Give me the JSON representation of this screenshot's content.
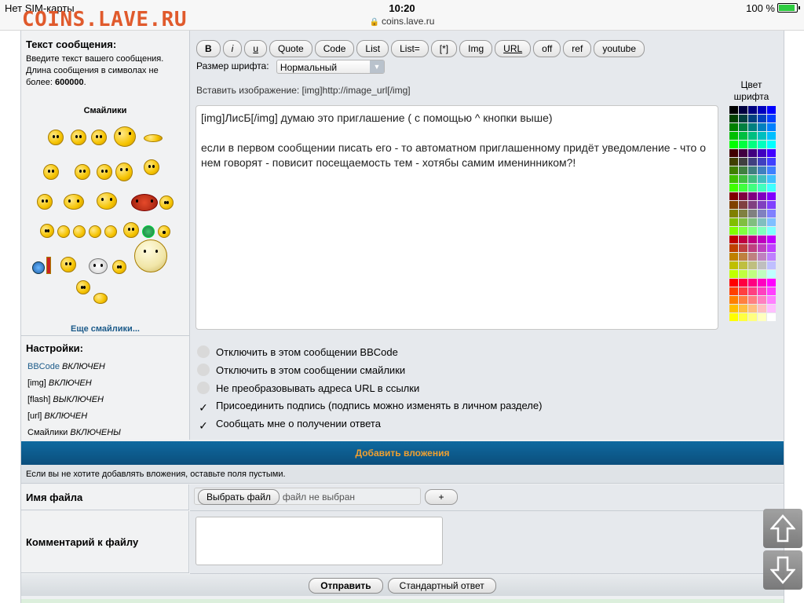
{
  "status": {
    "carrier": "Нет SIM-карты",
    "time": "10:20",
    "battery": "100 %"
  },
  "browser": {
    "url": "coins.lave.ru",
    "site_title": "COINS.LAVE.RU"
  },
  "message_section": {
    "title": "Текст сообщения:",
    "hint_line1": "Введите текст вашего сообщения.",
    "hint_line2": "Длина сообщения в символах не",
    "hint_prefix": "более:",
    "max_len": "600000",
    "hint_period": ".",
    "smilies_title": "Смайлики",
    "more_smilies": "Еще смайлики..."
  },
  "toolbar": {
    "buttons": [
      "B",
      "i",
      "u",
      "Quote",
      "Code",
      "List",
      "List=",
      "[*]",
      "Img",
      "URL",
      "off",
      "ref",
      "youtube"
    ]
  },
  "font_size": {
    "label": "Размер шрифта:",
    "selected": "Нормальный"
  },
  "insert_image_hint": "Вставить изображение: [img]http://image_url[/img]",
  "editor": {
    "line1": "[img]ЛисБ[/img] думаю это приглашение ( с помощью ^ кнопки выше)",
    "line2": "если в первом сообщении писать его - то автоматном приглашенному придёт уведомление - что о нем говорят - повисит посещаемость тем - хотябы самим именинником?!"
  },
  "color_label": {
    "line1": "Цвет",
    "line2": "шрифта"
  },
  "settings": {
    "title": "Настройки:",
    "rows": [
      {
        "name": "BBCode",
        "state": "ВКЛЮЧЕН"
      },
      {
        "name": "[img]",
        "state": "ВКЛЮЧЕН"
      },
      {
        "name": "[flash]",
        "state": "ВЫКЛЮЧЕН"
      },
      {
        "name": "[url]",
        "state": "ВКЛЮЧЕН"
      },
      {
        "name": "Смайлики",
        "state": "ВКЛЮЧЕНЫ"
      }
    ],
    "options": [
      {
        "label": "Отключить в этом сообщении BBCode",
        "checked": false
      },
      {
        "label": "Отключить в этом сообщении смайлики",
        "checked": false
      },
      {
        "label": "Не преобразовывать адреса URL в ссылки",
        "checked": false
      },
      {
        "label": "Присоединить подпись (подпись можно изменять в личном разделе)",
        "checked": true
      },
      {
        "label": "Сообщать мне о получении ответа",
        "checked": true
      }
    ],
    "check_mark": "✓"
  },
  "attachments": {
    "title": "Добавить вложения",
    "note": "Если вы не хотите добавлять вложения, оставьте поля пустыми.",
    "file_label": "Имя файла",
    "choose_button": "Выбрать файл",
    "no_file": "файл не выбран",
    "plus": "+",
    "comment_label": "Комментарий к файлу"
  },
  "submit": {
    "send": "Отправить",
    "standard": "Стандартный ответ"
  },
  "colors": {
    "accent_bar": "#0d5c8e",
    "accent_text": "#f0a030",
    "site_title": "#e05a2c"
  }
}
